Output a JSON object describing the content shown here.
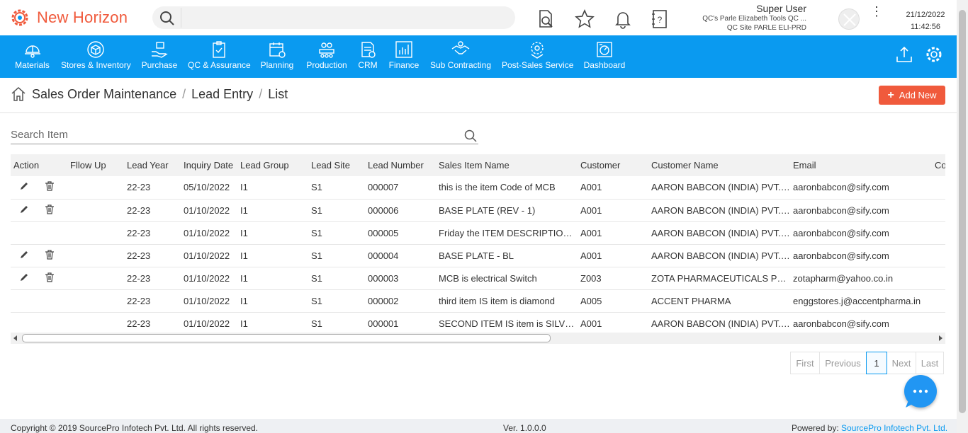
{
  "app": {
    "title": "New Horizon",
    "brand_color": "#f05a3c",
    "nav_color": "#0a9af0"
  },
  "header": {
    "search_placeholder": "",
    "user_name": "Super User",
    "company": "QC's Parle Elizabeth Tools QC ...",
    "site": "QC Site PARLE ELI-PRD",
    "date": "21/12/2022",
    "time": "11:42:56",
    "icons": [
      "document-search-icon",
      "star-icon",
      "bell-icon",
      "help-book-icon"
    ]
  },
  "nav": {
    "items": [
      {
        "label": "Materials",
        "icon": "helmet-icon"
      },
      {
        "label": "Stores & Inventory",
        "icon": "box-icon"
      },
      {
        "label": "Purchase",
        "icon": "hand-cart-icon"
      },
      {
        "label": "QC & Assurance",
        "icon": "clipboard-check-icon"
      },
      {
        "label": "Planning",
        "icon": "calendar-clock-icon"
      },
      {
        "label": "Production",
        "icon": "factory-icon"
      },
      {
        "label": "CRM",
        "icon": "crm-doc-icon"
      },
      {
        "label": "Finance",
        "icon": "bar-chart-icon"
      },
      {
        "label": "Sub Contracting",
        "icon": "handshake-icon"
      },
      {
        "label": "Post-Sales Service",
        "icon": "service-gear-icon"
      },
      {
        "label": "Dashboard",
        "icon": "dashboard-icon"
      }
    ]
  },
  "breadcrumb": {
    "items": [
      "Sales Order Maintenance",
      "Lead Entry",
      "List"
    ]
  },
  "actions": {
    "add_new": "Add New"
  },
  "search": {
    "placeholder": "Search Item"
  },
  "table": {
    "columns": [
      "Action",
      "Fllow Up",
      "Lead Year",
      "Inquiry Date",
      "Lead Group",
      "Lead Site",
      "Lead Number",
      "Sales Item Name",
      "Customer",
      "Customer Name",
      "Email",
      "Co"
    ],
    "rows": [
      {
        "editable": true,
        "lead_year": "22-23",
        "inquiry_date": "05/10/2022",
        "lead_group": "I1",
        "lead_site": "S1",
        "lead_number": "000007",
        "sales_item": "this is the item Code of MCB",
        "customer": "A001",
        "customer_name": "AARON BABCON (INDIA) PVT. LTD.",
        "email": "aaronbabcon@sify.com"
      },
      {
        "editable": true,
        "lead_year": "22-23",
        "inquiry_date": "01/10/2022",
        "lead_group": "I1",
        "lead_site": "S1",
        "lead_number": "000006",
        "sales_item": "BASE PLATE (REV - 1)",
        "customer": "A001",
        "customer_name": "AARON BABCON (INDIA) PVT. LTD.",
        "email": "aaronbabcon@sify.com"
      },
      {
        "editable": false,
        "lead_year": "22-23",
        "inquiry_date": "01/10/2022",
        "lead_group": "I1",
        "lead_site": "S1",
        "lead_number": "000005",
        "sales_item": "Friday the ITEM DESCRIPTION item",
        "customer": "A001",
        "customer_name": "AARON BABCON (INDIA) PVT. LTD.",
        "email": "aaronbabcon@sify.com"
      },
      {
        "editable": true,
        "lead_year": "22-23",
        "inquiry_date": "01/10/2022",
        "lead_group": "I1",
        "lead_site": "S1",
        "lead_number": "000004",
        "sales_item": "BASE PLATE - BL",
        "customer": "A001",
        "customer_name": "AARON BABCON (INDIA) PVT. LTD.",
        "email": "aaronbabcon@sify.com"
      },
      {
        "editable": true,
        "lead_year": "22-23",
        "inquiry_date": "01/10/2022",
        "lead_group": "I1",
        "lead_site": "S1",
        "lead_number": "000003",
        "sales_item": "MCB is electrical Switch",
        "customer": "Z003",
        "customer_name": "ZOTA PHARMACEUTICALS PVT. LTD.",
        "email": "zotapharm@yahoo.co.in"
      },
      {
        "editable": false,
        "lead_year": "22-23",
        "inquiry_date": "01/10/2022",
        "lead_group": "I1",
        "lead_site": "S1",
        "lead_number": "000002",
        "sales_item": "third item IS item is diamond",
        "customer": "A005",
        "customer_name": "ACCENT PHARMA",
        "email": "enggstores.j@accentpharma.in"
      },
      {
        "editable": false,
        "lead_year": "22-23",
        "inquiry_date": "01/10/2022",
        "lead_group": "I1",
        "lead_site": "S1",
        "lead_number": "000001",
        "sales_item": "SECOND ITEM IS item is SILVER",
        "customer": "A001",
        "customer_name": "AARON BABCON (INDIA) PVT. LTD.",
        "email": "aaronbabcon@sify.com"
      }
    ]
  },
  "pagination": {
    "first": "First",
    "previous": "Previous",
    "current": "1",
    "next": "Next",
    "last": "Last"
  },
  "footer": {
    "copyright": "Copyright © 2019 SourcePro Infotech Pvt. Ltd. All rights reserved.",
    "version": "Ver. 1.0.0.0",
    "powered_label": "Powered by:",
    "powered_link": "SourcePro Infotech Pvt. Ltd."
  }
}
